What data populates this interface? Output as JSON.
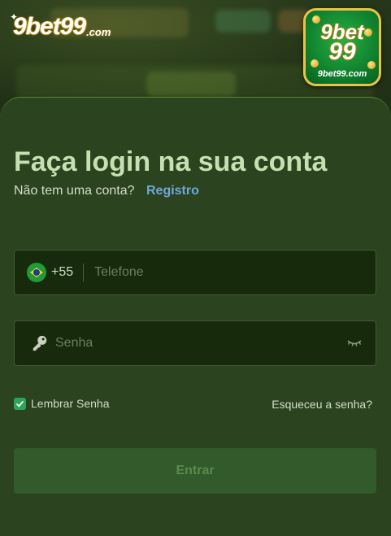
{
  "header": {
    "logo_main": "9bet99",
    "logo_domain": ".com",
    "app_badge": {
      "line1": "9bet",
      "line2": "99",
      "domain": "9bet99.com"
    }
  },
  "login": {
    "title": "Faça login na sua conta",
    "no_account_text": "Não tem uma conta?",
    "register_link": "Registro",
    "phone": {
      "country_code": "+55",
      "flag_icon": "brazil-flag-icon",
      "placeholder": "Telefone",
      "value": ""
    },
    "password": {
      "placeholder": "Senha",
      "value": "",
      "key_icon": "key-icon",
      "visibility_icon": "eye-closed-icon"
    },
    "remember_label": "Lembrar Senha",
    "remember_checked": true,
    "forgot_link": "Esqueceu a senha?",
    "submit_label": "Entrar"
  },
  "colors": {
    "background": "#1b2b12",
    "sheet": "#2b431f",
    "title": "#c8dfb1",
    "link": "#6fa7da",
    "checkbox": "#2ea35a",
    "submit_bg": "#325a2a",
    "submit_text": "#5b8a4c"
  }
}
